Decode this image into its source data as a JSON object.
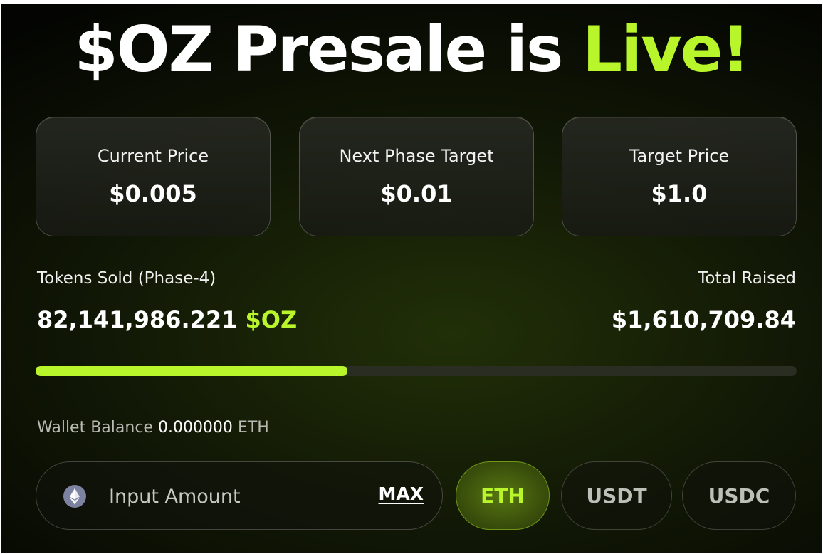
{
  "headline": {
    "prefix": "$OZ Presale is ",
    "highlight": "Live!",
    "highlight_color": "#b8f52b"
  },
  "price_cards": [
    {
      "label": "Current Price",
      "value": "$0.005"
    },
    {
      "label": "Next Phase Target",
      "value": "$0.01"
    },
    {
      "label": "Target Price",
      "value": "$1.0"
    }
  ],
  "tokens_sold": {
    "label": "Tokens Sold (Phase-4)",
    "amount": "82,141,986.221",
    "unit": "$OZ"
  },
  "total_raised": {
    "label": "Total Raised",
    "amount": "$1,610,709.84"
  },
  "progress": {
    "fraction": 0.41,
    "fill_color": "#b8f52b"
  },
  "wallet": {
    "label": "Wallet Balance",
    "balance": "0.000000",
    "unit": "ETH"
  },
  "amount_input": {
    "placeholder": "Input Amount",
    "value": "",
    "token_icon": "ethereum-icon",
    "max_label": "MAX"
  },
  "currency_options": [
    {
      "label": "ETH",
      "selected": true
    },
    {
      "label": "USDT",
      "selected": false
    },
    {
      "label": "USDC",
      "selected": false
    }
  ]
}
